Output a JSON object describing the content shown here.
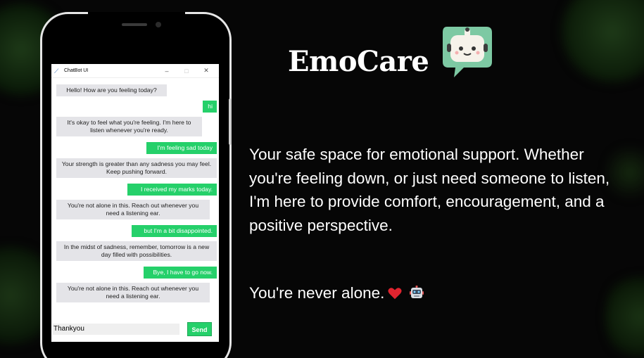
{
  "brand": "EmoCare",
  "window": {
    "title": "ChatBot UI",
    "minimize": "–",
    "maximize": "□",
    "close": "✕"
  },
  "messages": [
    {
      "from": "bot",
      "text": "Hello! How are you feeling today?"
    },
    {
      "from": "user",
      "text": "hi"
    },
    {
      "from": "bot",
      "text": "It's okay to feel what you're feeling. I'm here to listen whenever you're ready."
    },
    {
      "from": "user",
      "text": "I'm feeling sad today"
    },
    {
      "from": "bot",
      "text": "Your strength is greater than any sadness you may feel. Keep pushing forward."
    },
    {
      "from": "user",
      "text": "I received my marks today."
    },
    {
      "from": "bot",
      "text": "You're not alone in this. Reach out whenever you need a listening ear."
    },
    {
      "from": "user",
      "text": "but I'm a bit disappointed."
    },
    {
      "from": "bot",
      "text": "In the midst of sadness, remember, tomorrow is a new day filled with possibilities."
    },
    {
      "from": "user",
      "text": "Bye, I have to go now."
    },
    {
      "from": "bot",
      "text": "You're not alone in this. Reach out whenever you need a listening ear."
    }
  ],
  "input": {
    "value": "Thankyou"
  },
  "send_label": "Send",
  "description": "Your safe space for emotional support. Whether you're feeling down,  or just need someone to listen, I'm here to provide comfort, encouragement, and a positive perspective.",
  "tagline": "You're never alone.",
  "colors": {
    "user_bubble": "#25d06a",
    "bot_bubble": "#e4e4e8",
    "logo": "#7dc9a3"
  },
  "icons": [
    "feather-icon",
    "heart-icon",
    "robot-icon",
    "chatbot-logo-icon"
  ]
}
